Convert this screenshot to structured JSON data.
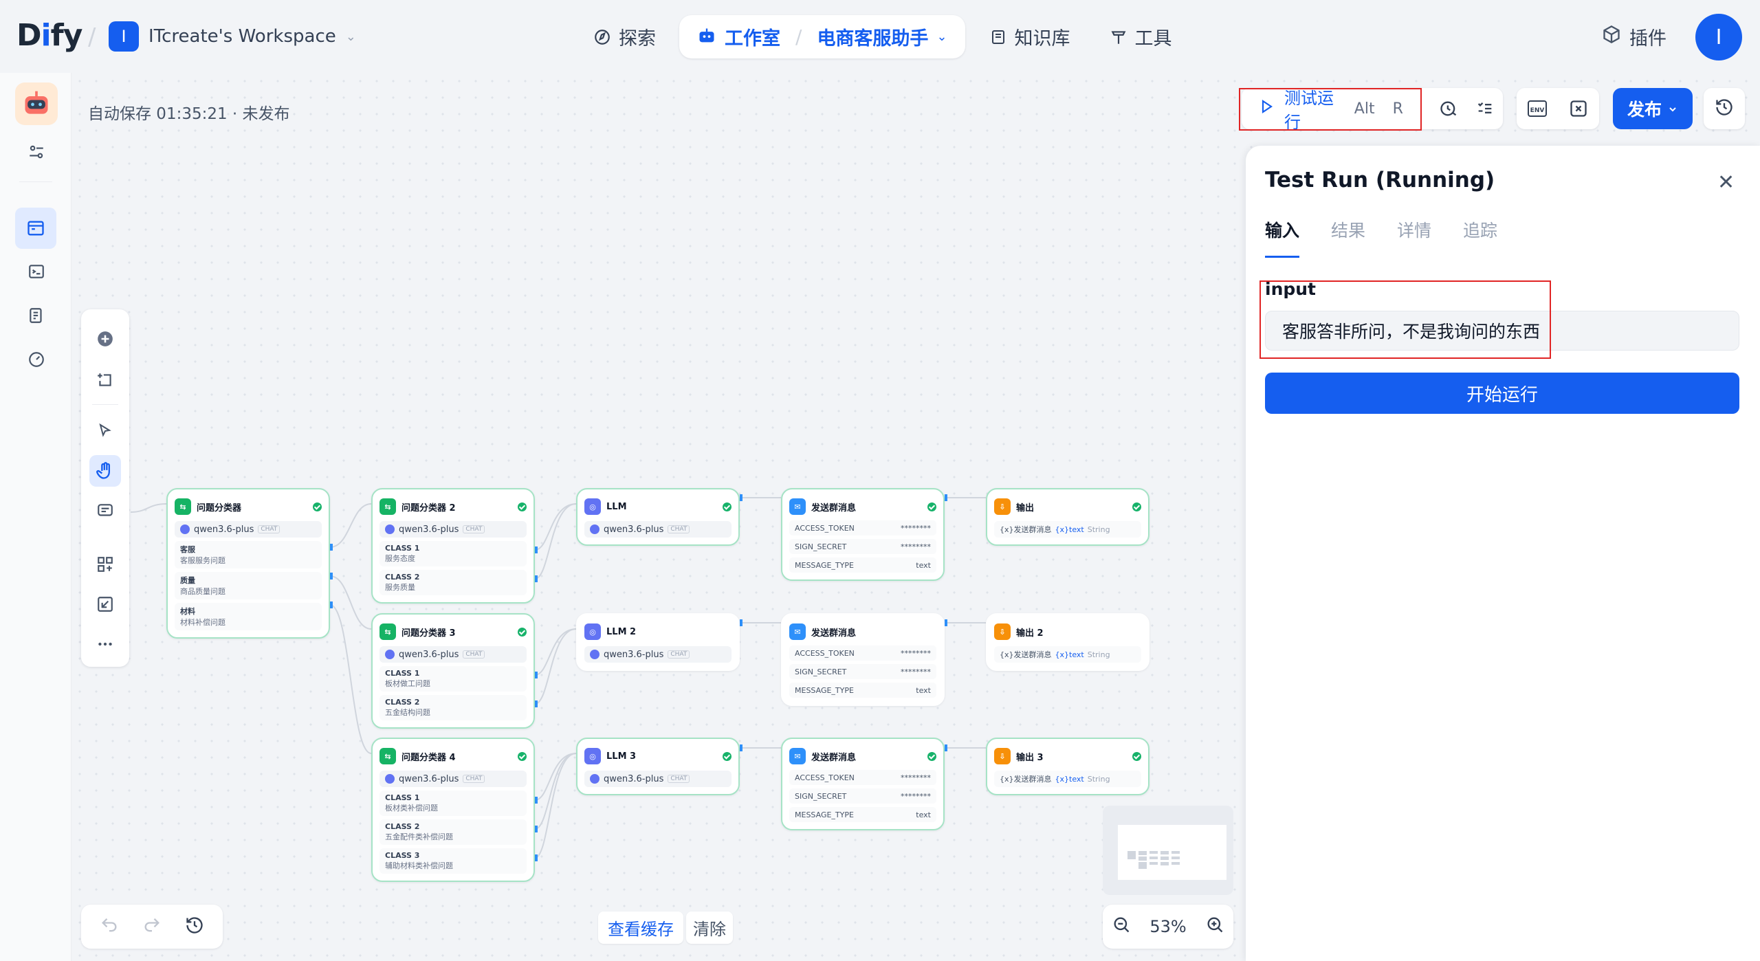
{
  "header": {
    "logo": "Dify",
    "workspace_initial": "I",
    "workspace_name": "ITcreate's Workspace",
    "nav": {
      "explore": "探索",
      "studio": "工作室",
      "app_name": "电商客服助手",
      "knowledge": "知识库",
      "tools": "工具"
    },
    "plugins": "插件",
    "user_initial": "I"
  },
  "canvas": {
    "autosave": "自动保存 01:35:21 · 未发布",
    "toolbar": {
      "test_run": "测试运行",
      "kbd_alt": "Alt",
      "kbd_r": "R",
      "env": "ENV",
      "publish": "发布"
    },
    "bottom": {
      "view_cache": "查看缓存",
      "clear": "清除",
      "zoom": "53%"
    }
  },
  "nodes": {
    "qc1": {
      "title": "问题分类器",
      "model": "qwen3.6-plus",
      "tag": "CHAT",
      "classes": [
        {
          "name": "客服",
          "desc": "客服服务问题"
        },
        {
          "name": "质量",
          "desc": "商品质量问题"
        },
        {
          "name": "材料",
          "desc": "材料补偿问题"
        }
      ]
    },
    "qc2": {
      "title": "问题分类器 2",
      "model": "qwen3.6-plus",
      "tag": "CHAT",
      "classes": [
        {
          "name": "CLASS 1",
          "desc": "服务态度"
        },
        {
          "name": "CLASS 2",
          "desc": "服务质量"
        }
      ]
    },
    "qc3": {
      "title": "问题分类器 3",
      "model": "qwen3.6-plus",
      "tag": "CHAT",
      "classes": [
        {
          "name": "CLASS 1",
          "desc": "板材做工问题"
        },
        {
          "name": "CLASS 2",
          "desc": "五金结构问题"
        }
      ]
    },
    "qc4": {
      "title": "问题分类器 4",
      "model": "qwen3.6-plus",
      "tag": "CHAT",
      "classes": [
        {
          "name": "CLASS 1",
          "desc": "板材类补偿问题"
        },
        {
          "name": "CLASS 2",
          "desc": "五金配件类补偿问题"
        },
        {
          "name": "CLASS 3",
          "desc": "辅助材料类补偿问题"
        }
      ]
    },
    "llm1": {
      "title": "LLM",
      "model": "qwen3.6-plus",
      "tag": "CHAT"
    },
    "llm2": {
      "title": "LLM 2",
      "model": "qwen3.6-plus",
      "tag": "CHAT"
    },
    "llm3": {
      "title": "LLM 3",
      "model": "qwen3.6-plus",
      "tag": "CHAT"
    },
    "msg": {
      "title": "发送群消息",
      "access_token": "ACCESS_TOKEN",
      "sign_secret": "SIGN_SECRET",
      "message_type": "MESSAGE_TYPE",
      "masked": "********",
      "type_value": "text"
    },
    "out1": {
      "title": "输出",
      "src": "{x}发送群消息",
      "var": "{x}text",
      "type": "String"
    },
    "out2": {
      "title": "输出 2",
      "src": "{x}发送群消息",
      "var": "{x}text",
      "type": "String"
    },
    "out3": {
      "title": "输出 3",
      "src": "{x}发送群消息",
      "var": "{x}text",
      "type": "String"
    }
  },
  "panel": {
    "title": "Test Run (Running)",
    "tabs": [
      "输入",
      "结果",
      "详情",
      "追踪"
    ],
    "field_label": "input",
    "field_value": "客服答非所问，不是我询问的东西",
    "start_button": "开始运行"
  }
}
